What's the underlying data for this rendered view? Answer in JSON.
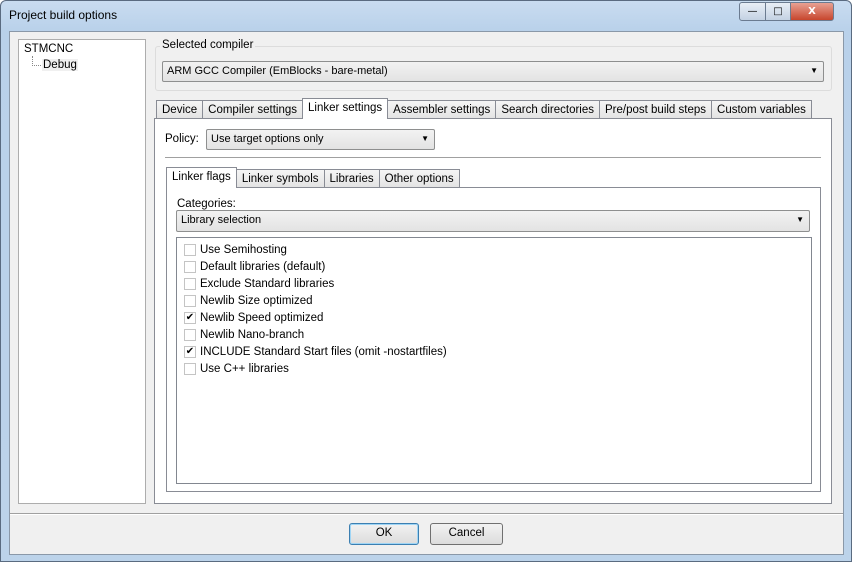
{
  "window": {
    "title": "Project build options",
    "minimize": "—",
    "maximize": "□",
    "close": "X"
  },
  "tree": {
    "root": "STMCNC",
    "child": "Debug"
  },
  "compiler": {
    "label": "Selected compiler",
    "value": "ARM GCC Compiler (EmBlocks - bare-metal)"
  },
  "tabs": [
    "Device",
    "Compiler settings",
    "Linker settings",
    "Assembler settings",
    "Search directories",
    "Pre/post build steps",
    "Custom variables"
  ],
  "active_tab": "Linker settings",
  "policy": {
    "label": "Policy:",
    "value": "Use target options only"
  },
  "inner_tabs": [
    "Linker flags",
    "Linker symbols",
    "Libraries",
    "Other options"
  ],
  "categories": {
    "label": "Categories:",
    "value": "Library selection"
  },
  "options": [
    {
      "label": "Use Semihosting",
      "checked": false
    },
    {
      "label": "Default libraries (default)",
      "checked": false
    },
    {
      "label": "Exclude Standard libraries",
      "checked": false
    },
    {
      "label": "Newlib Size optimized",
      "checked": false
    },
    {
      "label": "Newlib Speed optimized",
      "checked": true
    },
    {
      "label": "Newlib Nano-branch",
      "checked": false
    },
    {
      "label": "INCLUDE Standard Start files (omit -nostartfiles)",
      "checked": true
    },
    {
      "label": "Use C++ libraries",
      "checked": false
    }
  ],
  "buttons": {
    "ok": "OK",
    "cancel": "Cancel"
  }
}
